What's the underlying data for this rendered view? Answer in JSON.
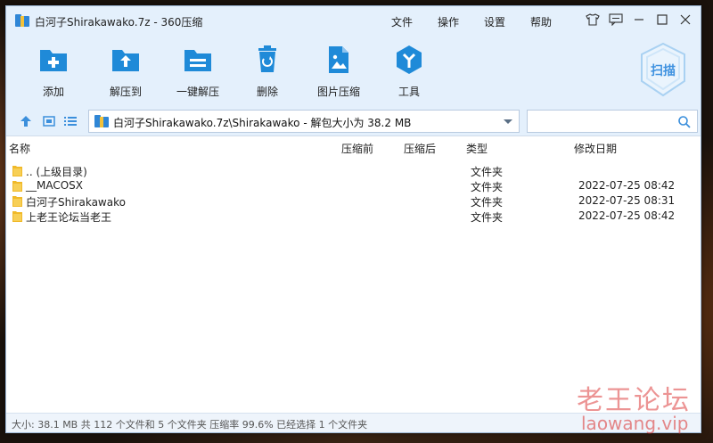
{
  "window": {
    "title": "白河子Shirakawako.7z - 360压缩"
  },
  "menu": [
    "文件",
    "操作",
    "设置",
    "帮助"
  ],
  "toolbar": {
    "add": "添加",
    "extract_to": "解压到",
    "one_click_extract": "一键解压",
    "delete": "删除",
    "image_compress": "图片压缩",
    "tools": "工具",
    "scan": "扫描"
  },
  "address": {
    "path": "白河子Shirakawako.7z\\Shirakawako - 解包大小为 38.2 MB",
    "search_placeholder": ""
  },
  "columns": {
    "name": "名称",
    "before": "压缩前",
    "after": "压缩后",
    "type": "类型",
    "modified": "修改日期"
  },
  "rows": [
    {
      "name": ".. (上级目录)",
      "type": "文件夹",
      "date": ""
    },
    {
      "name": "__MACOSX",
      "type": "文件夹",
      "date": "2022-07-25 08:42"
    },
    {
      "name": "白河子Shirakawako",
      "type": "文件夹",
      "date": "2022-07-25 08:31"
    },
    {
      "name": "上老王论坛当老王",
      "type": "文件夹",
      "date": "2022-07-25 08:42"
    }
  ],
  "status": "大小: 38.1 MB 共 112 个文件和 5 个文件夹 压缩率 99.6% 已经选择 1 个文件夹",
  "watermark": {
    "line1": "老王论坛",
    "line2": "laowang.vip"
  },
  "colors": {
    "accent": "#1f8ad8",
    "folder": "#f0b929",
    "toolbar_bg": "#e4f0fc"
  }
}
